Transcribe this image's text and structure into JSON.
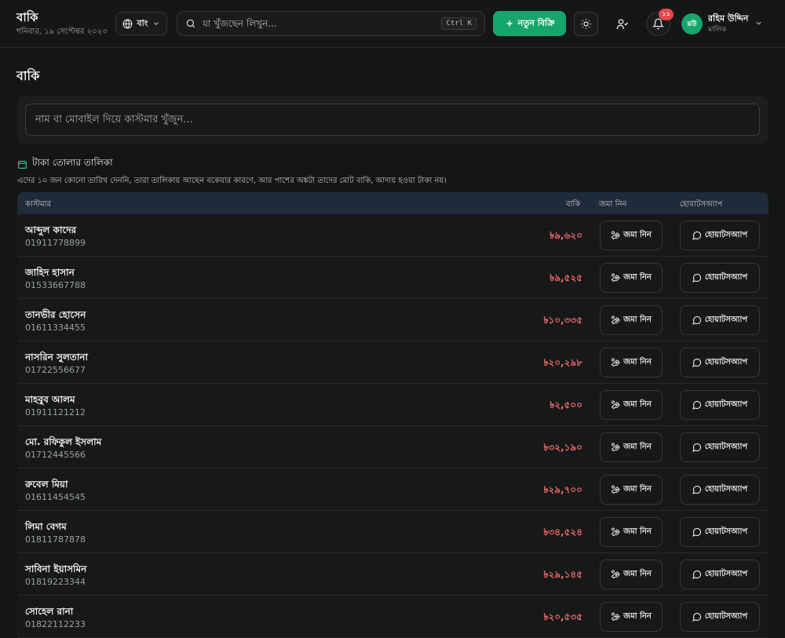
{
  "header": {
    "title": "বাকি",
    "date": "শনিবার, ১৯ সেপ্টেম্বর ২০২৩",
    "language": "বাং",
    "search_placeholder": "যা খুঁজছেন লিখুন...",
    "search_shortcut": "Ctrl K",
    "new_sale_label": "নতুন বিক্রি",
    "notification_count": "১১",
    "user": {
      "initials": "রউ",
      "name": "রহিম উদ্দিন",
      "role": "মালিক"
    }
  },
  "page": {
    "title": "বাকি",
    "customer_search_placeholder": "নাম বা মোবাইল দিয়ে কাস্টমার খুঁজুন...",
    "section_title": "টাকা তোলার তালিকা",
    "section_note": "এদের ১০ জন কোনো তারিখ দেননি, তারা তালিকায় আছেন বকেয়ার কারণে, আর পাশের অঙ্কটা তাদের মোট বাকি, আদায় হওয়া টাকা নয়।"
  },
  "table": {
    "headers": {
      "customer": "কাস্টমার",
      "due": "বাকি",
      "collect": "জমা নিন",
      "whatsapp": "হোয়াটসঅ্যাপ"
    },
    "collect_label": "জমা নিন",
    "whatsapp_label": "হোয়াটসঅ্যাপ",
    "rows": [
      {
        "name": "আব্দুল কাদের",
        "phone": "01911778899",
        "due": "৳৯,৬২০"
      },
      {
        "name": "জাহিদ হাসান",
        "phone": "01533667788",
        "due": "৳৯,৫২৫"
      },
      {
        "name": "তানভীর হোসেন",
        "phone": "01611334455",
        "due": "৳১০,৩৩৫"
      },
      {
        "name": "নাসরিন সুলতানা",
        "phone": "01722556677",
        "due": "৳২০,২৯৮"
      },
      {
        "name": "মাহবুব আলম",
        "phone": "01911121212",
        "due": "৳২,৫০০"
      },
      {
        "name": "মো. রফিকুল ইসলাম",
        "phone": "01712445566",
        "due": "৳৩২,১৯০"
      },
      {
        "name": "রুবেল মিয়া",
        "phone": "01611454545",
        "due": "৳২৯,৭০০"
      },
      {
        "name": "লিমা বেগম",
        "phone": "01811787878",
        "due": "৳৩৪,৫২৪"
      },
      {
        "name": "সাবিনা ইয়াসমিন",
        "phone": "01819223344",
        "due": "৳২৯,১৪৫"
      },
      {
        "name": "সোহেল রানা",
        "phone": "01822112233",
        "due": "৳২০,৫৩৫"
      }
    ]
  },
  "colors": {
    "accent": "#16a56b",
    "due": "#f06b6b",
    "badge": "#e5484d",
    "table_header": "#1f2a3a"
  }
}
